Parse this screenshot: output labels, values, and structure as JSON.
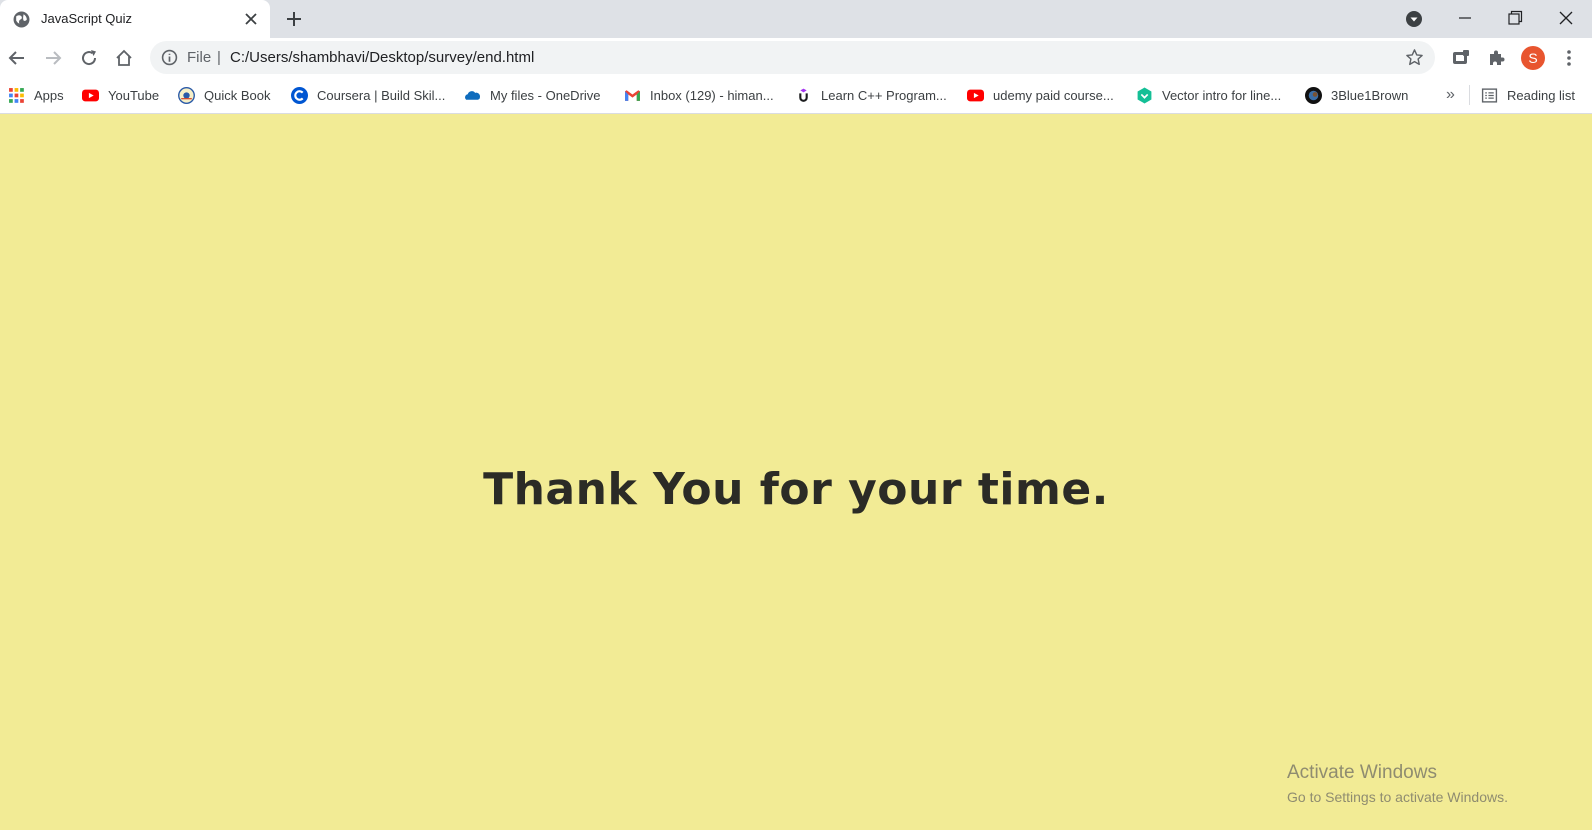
{
  "window": {
    "tab_title": "JavaScript Quiz",
    "icons": {
      "tab_favicon": "globe-icon",
      "tab_close": "close-icon",
      "new_tab": "plus-icon",
      "tab_search": "chevron-down-icon",
      "minimize": "minimize-icon",
      "restore": "restore-icon",
      "close": "close-icon"
    }
  },
  "toolbar": {
    "scheme_label": "File",
    "separator": "|",
    "url": "C:/Users/shambhavi/Desktop/survey/end.html",
    "profile_initial": "S",
    "profile_color": "#e8552f",
    "icons": [
      "back-icon",
      "forward-icon",
      "reload-icon",
      "home-icon",
      "info-icon",
      "star-icon",
      "extension-icon",
      "puzzle-icon",
      "kebab-menu-icon"
    ]
  },
  "bookmarks": {
    "items": [
      {
        "label": "Apps",
        "icon": "apps-grid-icon"
      },
      {
        "label": "YouTube",
        "icon": "youtube-icon"
      },
      {
        "label": "Quick Book",
        "icon": "railway-icon"
      },
      {
        "label": "Coursera | Build Skil...",
        "icon": "coursera-icon"
      },
      {
        "label": "My files - OneDrive",
        "icon": "onedrive-icon"
      },
      {
        "label": "Inbox (129) - himan...",
        "icon": "gmail-icon"
      },
      {
        "label": "Learn C++ Program...",
        "icon": "udemy-icon"
      },
      {
        "label": "udemy paid course...",
        "icon": "youtube-icon"
      },
      {
        "label": "Vector intro for line...",
        "icon": "khan-academy-icon"
      },
      {
        "label": "3Blue1Brown",
        "icon": "3blue1brown-icon"
      }
    ],
    "overflow_label": "»",
    "reading_list_label": "Reading list"
  },
  "page": {
    "message": "Thank You for your time.",
    "background": "#f2eb95"
  },
  "watermark": {
    "title": "Activate Windows",
    "subtitle": "Go to Settings to activate Windows."
  }
}
